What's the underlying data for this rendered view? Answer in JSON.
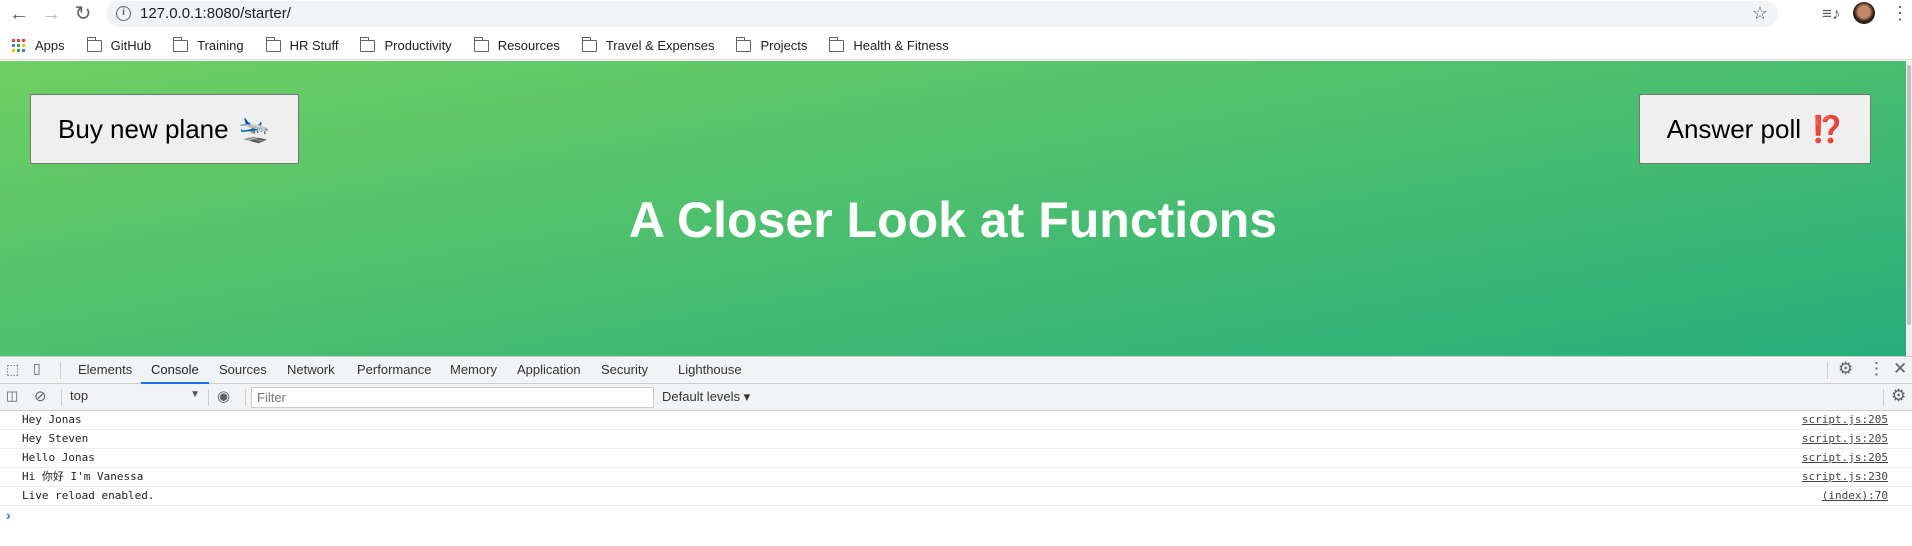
{
  "browser": {
    "url": "127.0.0.1:8080/starter/",
    "bookmarks": [
      "Apps",
      "GitHub",
      "Training",
      "HR Stuff",
      "Productivity",
      "Resources",
      "Travel & Expenses",
      "Projects",
      "Health & Fitness"
    ]
  },
  "page": {
    "buy_button": "Buy new plane",
    "buy_emoji": "🛬",
    "poll_button": "Answer poll",
    "poll_emoji": "⁉️",
    "title": "A Closer Look at Functions"
  },
  "devtools": {
    "tabs": [
      "Elements",
      "Console",
      "Sources",
      "Network",
      "Performance",
      "Memory",
      "Application",
      "Security",
      "Lighthouse"
    ],
    "context": "top",
    "filter_placeholder": "Filter",
    "levels": "Default levels ▾",
    "messages": [
      {
        "text": "Hey Jonas",
        "source": "script.js:205"
      },
      {
        "text": "Hey Steven",
        "source": "script.js:205"
      },
      {
        "text": "Hello Jonas",
        "source": "script.js:205"
      },
      {
        "text": "Hi 你好 I'm Vanessa",
        "source": "script.js:230"
      },
      {
        "text": "Live reload enabled.",
        "source": "(index):70"
      }
    ],
    "prompt": "›"
  }
}
